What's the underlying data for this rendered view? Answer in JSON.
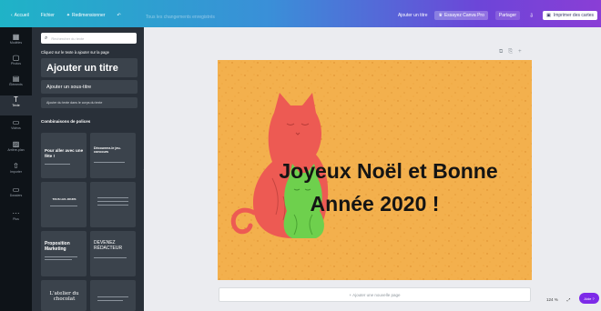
{
  "topbar": {
    "home_label": "Accueil",
    "file_label": "Fichier",
    "resize_label": "Redimensionner",
    "undo_icon": "undo-icon",
    "doc_title": "Tous les changements enregistrés",
    "add_users": "Ajouter un titre",
    "upgrade": "Essayez Canva Pro",
    "share": "Partager",
    "download_icon": "download-icon",
    "print": "Imprimer des cartes"
  },
  "rail": {
    "items": [
      {
        "label": "Modèles",
        "icon": "template-icon"
      },
      {
        "label": "Photos",
        "icon": "photo-icon"
      },
      {
        "label": "Éléments",
        "icon": "elements-icon"
      },
      {
        "label": "Texte",
        "icon": "text-icon"
      },
      {
        "label": "Vidéos",
        "icon": "video-icon"
      },
      {
        "label": "Arrière-plan",
        "icon": "background-icon"
      },
      {
        "label": "Importer",
        "icon": "upload-icon"
      },
      {
        "label": "Dossiers",
        "icon": "folder-icon"
      },
      {
        "label": "Plus",
        "icon": "more-icon"
      }
    ]
  },
  "panel": {
    "search_placeholder": "Rechercher du texte",
    "hint": "Cliquez sur le texte à ajouter sur la page",
    "add_title": "Ajouter un titre",
    "add_subtitle": "Ajouter un sous-titre",
    "add_body": "Ajouter du texte dans le corps du texte",
    "combos_title": "Combinaisons de polices",
    "combos": [
      {
        "text": "Pour aller avec une fête !",
        "sub": ""
      },
      {
        "text": "Découvrez-le jeu-concours",
        "sub": ""
      },
      {
        "text": "TOUS LES JOURS",
        "sub": ""
      },
      {
        "text": "",
        "sub": ""
      },
      {
        "text": "Proposition Marketing",
        "sub": ""
      },
      {
        "text": "DEVENEZ RÉDACTEUR",
        "sub": ""
      },
      {
        "text": "L'atelier du chocolat",
        "sub": ""
      },
      {
        "text": "",
        "sub": ""
      }
    ]
  },
  "canvas": {
    "line1": "Joyeux Noël et Bonne",
    "line2": "Année 2020 !",
    "bg_color": "#f3b04d",
    "cat_red": "#ed5a53",
    "cat_green": "#6ed04d"
  },
  "add_page_label": "+ Ajouter une nouvelle page",
  "zoom_label": "124 %",
  "help_label": "Aide ?"
}
